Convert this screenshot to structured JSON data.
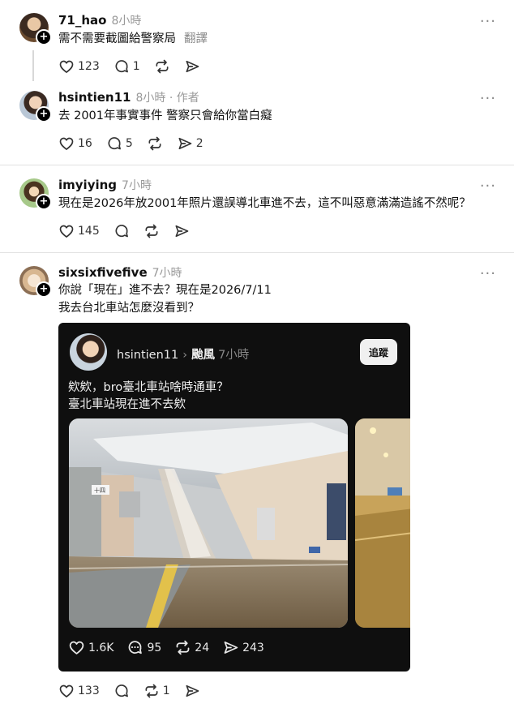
{
  "posts": [
    {
      "username": "71_hao",
      "time": "8小時",
      "text": "需不需要截圖給警察局",
      "translate": "翻譯",
      "likes": "123",
      "replies": "1",
      "reposts": "",
      "shares": ""
    },
    {
      "username": "hsintien11",
      "time": "8小時 · 作者",
      "text": "去 2001年事實事件 警察只會給你當白癡",
      "likes": "16",
      "replies": "5",
      "reposts": "",
      "shares": "2"
    },
    {
      "username": "imyiying",
      "time": "7小時",
      "text": "現在是2026年放2001年照片還誤導北車進不去，這不叫惡意滿滿造謠不然呢？",
      "likes": "145",
      "replies": "",
      "reposts": "",
      "shares": ""
    },
    {
      "username": "sixsixfivefive",
      "time": "7小時",
      "text_line1": "你說「現在」進不去？現在是2026/7/11",
      "text_line2": "我去台北車站怎麼沒看到？",
      "likes": "133",
      "replies": "",
      "reposts": "1",
      "shares": ""
    }
  ],
  "quoted": {
    "username": "hsintien11",
    "separator": "›",
    "topic": "颱風",
    "time": "7小時",
    "follow_label": "追蹤",
    "text_line1": "欸欸，bro臺北車站啥時通車？",
    "text_line2": "臺北車站現在進不去欸",
    "photo_sign": "十四",
    "likes": "1.6K",
    "replies": "95",
    "reposts": "24",
    "shares": "243"
  },
  "colors": {
    "avatar_plus": "#000000",
    "divider": "#e2e2e2",
    "card_bg": "#0f0f0f",
    "muted_text": "#999999"
  },
  "icons": [
    "heart-icon",
    "comment-icon",
    "repost-icon",
    "share-icon",
    "more-icon",
    "plus-icon"
  ]
}
